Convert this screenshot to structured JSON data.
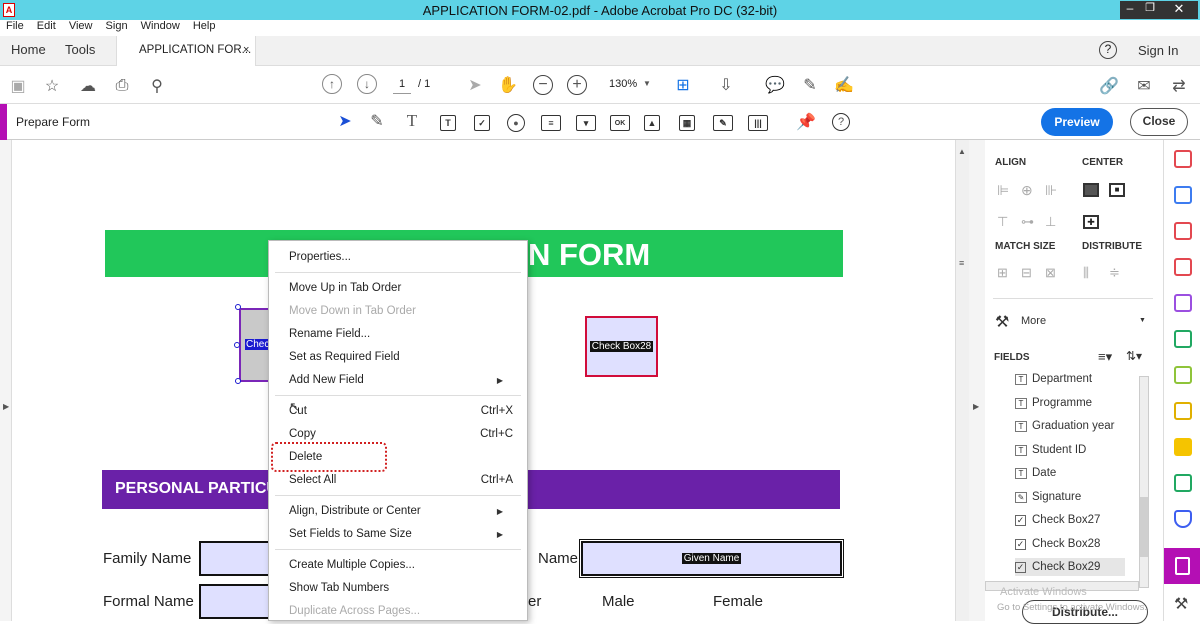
{
  "window": {
    "title": "APPLICATION FORM-02.pdf - Adobe Acrobat Pro DC (32-bit)"
  },
  "menu": [
    "File",
    "Edit",
    "View",
    "Sign",
    "Window",
    "Help"
  ],
  "tabs": {
    "home": "Home",
    "tools": "Tools",
    "doc": "APPLICATION FOR...",
    "close": "×",
    "help": "?",
    "signin": "Sign In"
  },
  "toolbar": {
    "page_current": "1",
    "page_total": "/ 1",
    "zoom": "130%"
  },
  "prepare": {
    "label": "Prepare Form",
    "preview": "Preview",
    "close": "Close",
    "ok": "OK"
  },
  "document": {
    "header_title": "N FORM",
    "checkbox_left": "Chec",
    "checkbox28": "Check Box28",
    "section": "PERSONAL PARTICU",
    "family_name": "Family Name",
    "given_name_label": "Name",
    "given_name_field": "Given Name",
    "formal_name": "Formal Name",
    "gender_partial": "er",
    "male": "Male",
    "female": "Female"
  },
  "context_menu": {
    "properties": "Properties...",
    "move_up": "Move Up in Tab Order",
    "move_down": "Move Down in Tab Order",
    "rename": "Rename Field...",
    "required": "Set as Required Field",
    "add_new": "Add New Field",
    "cut": "Cut",
    "cut_sc": "Ctrl+X",
    "copy": "Copy",
    "copy_sc": "Ctrl+C",
    "delete": "Delete",
    "select_all": "Select All",
    "select_all_sc": "Ctrl+A",
    "align": "Align, Distribute or Center",
    "same_size": "Set Fields to Same Size",
    "multiple": "Create Multiple Copies...",
    "tab_numbers": "Show Tab Numbers",
    "duplicate": "Duplicate Across Pages..."
  },
  "panel": {
    "align": "ALIGN",
    "center": "CENTER",
    "match_size": "MATCH SIZE",
    "distribute": "DISTRIBUTE",
    "more": "More",
    "fields": "FIELDS",
    "field_list": [
      "Department",
      "Programme",
      "Graduation year",
      "Student ID",
      "Date",
      "Signature",
      "Check Box27",
      "Check Box28",
      "Check Box29"
    ],
    "distribute_btn": "Distribute...",
    "watermark1": "Activate Windows",
    "watermark2": "Go to Settings to activate Windows."
  },
  "colors": {
    "titlebar": "#5ed3e6",
    "green": "#21c75a",
    "purple": "#6a21a8",
    "field_bg": "#dfe0ff",
    "accent_blue": "#1473e6",
    "red": "#d10c3a"
  }
}
